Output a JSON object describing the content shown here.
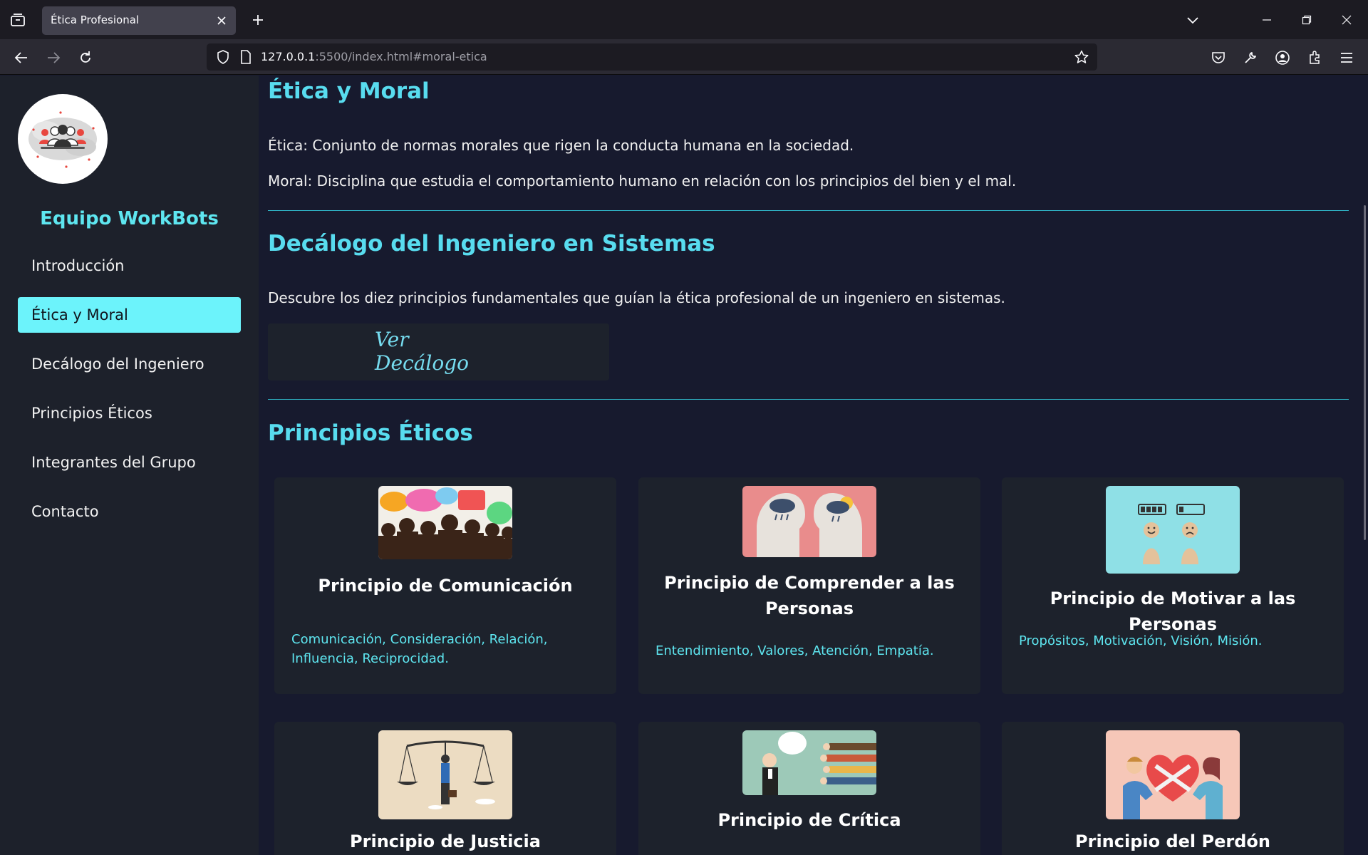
{
  "browser": {
    "tab_title": "Ética Profesional",
    "url_host": "127.0.0.1",
    "url_rest": ":5500/index.html#moral-etica"
  },
  "sidebar": {
    "brand": "Equipo WorkBots",
    "items": [
      {
        "label": "Introducción"
      },
      {
        "label": "Ética y Moral"
      },
      {
        "label": "Decálogo del Ingeniero"
      },
      {
        "label": "Principios Éticos"
      },
      {
        "label": "Integrantes del Grupo"
      },
      {
        "label": "Contacto"
      }
    ],
    "active_index": 1
  },
  "colors": {
    "accent": "#5ee6f0",
    "active_bg": "#6cf3fb",
    "page_bg": "#171a2e",
    "card_bg": "#1d222c"
  },
  "sections": {
    "etica_moral": {
      "title": "Ética y Moral",
      "p1": "Ética: Conjunto de normas morales que rigen la conducta humana en la sociedad.",
      "p2": "Moral: Disciplina que estudia el comportamiento humano en relación con los principios del bien y el mal."
    },
    "decalogo": {
      "title": "Decálogo del Ingeniero en Sistemas",
      "desc": "Descubre los diez principios fundamentales que guían la ética profesional de un ingeniero en sistemas.",
      "button_label": "Ver Decálogo"
    },
    "principios": {
      "title": "Principios Éticos",
      "cards": [
        {
          "title": "Principio de Comunicación",
          "text": "Comunicación, Consideración, Relación, Influencia, Reciprocidad."
        },
        {
          "title": "Principio de Comprender a las Personas",
          "text": "Entendimiento, Valores, Atención, Empatía."
        },
        {
          "title": "Principio de Motivar a las Personas",
          "text": "Propósitos, Motivación, Visión, Misión."
        },
        {
          "title": "Principio de Justicia",
          "text": ""
        },
        {
          "title": "Principio de Crítica",
          "text": ""
        },
        {
          "title": "Principio del Perdón",
          "text": ""
        }
      ]
    }
  }
}
